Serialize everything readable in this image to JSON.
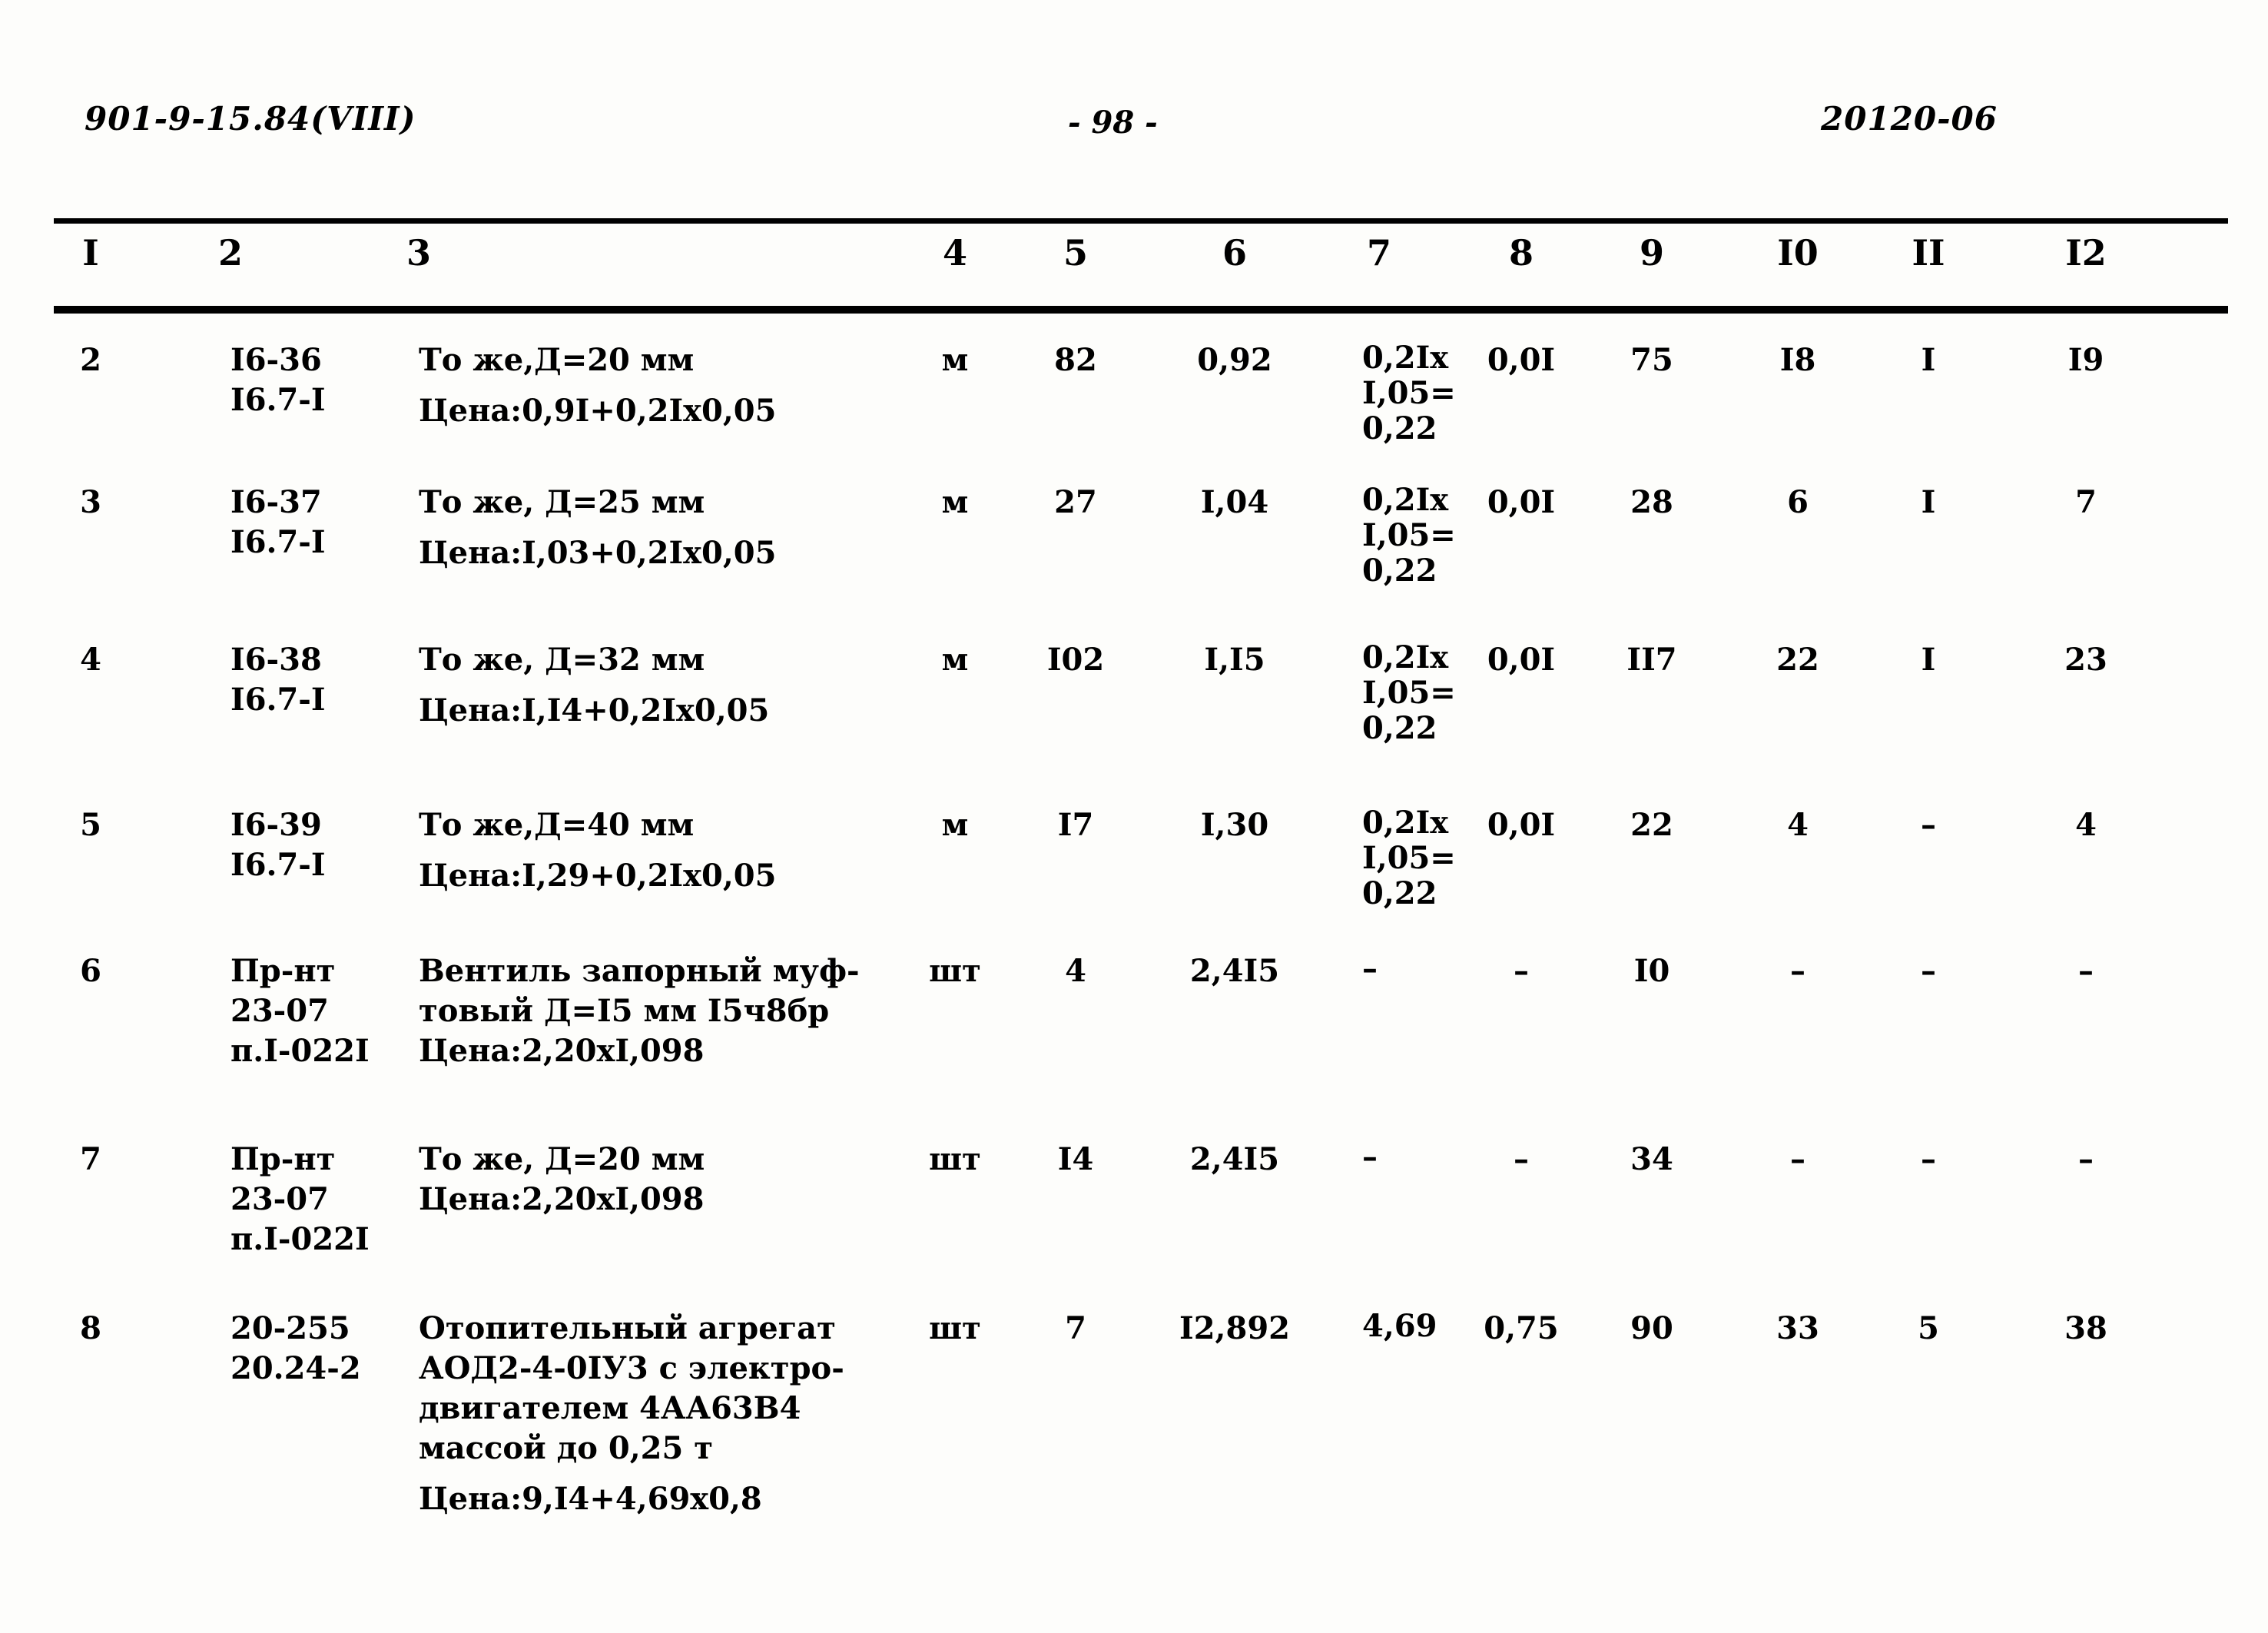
{
  "header": {
    "left_code": "901-9-15.84(VIII)",
    "page_number": "- 98 -",
    "right_code": "20120-06"
  },
  "table": {
    "column_headers": [
      "I",
      "2",
      "3",
      "4",
      "5",
      "6",
      "7",
      "8",
      "9",
      "I0",
      "II",
      "I2"
    ],
    "rows": [
      {
        "n": "2",
        "code_lines": [
          "I6-36",
          "I6.7-I"
        ],
        "desc_lines": [
          "То же,Д=20 мм",
          "",
          "Цена:0,9I+0,2Iх0,05"
        ],
        "unit": "м",
        "qty": "82",
        "c6": "0,92",
        "c7_l1": "0,2Iх",
        "c7_l2": "I,05=",
        "c7_l3": "0,22",
        "c8": "0,0I",
        "c9": "75",
        "c10": "I8",
        "c11": "I",
        "c12": "I9"
      },
      {
        "n": "3",
        "code_lines": [
          "I6-37",
          "I6.7-I"
        ],
        "desc_lines": [
          "То же, Д=25 мм",
          "",
          "Цена:I,03+0,2Iх0,05"
        ],
        "unit": "м",
        "qty": "27",
        "c6": "I,04",
        "c7_l1": "0,2Iх",
        "c7_l2": "I,05=",
        "c7_l3": "0,22",
        "c8": "0,0I",
        "c9": "28",
        "c10": "6",
        "c11": "I",
        "c12": "7"
      },
      {
        "n": "4",
        "code_lines": [
          "I6-38",
          "I6.7-I"
        ],
        "desc_lines": [
          "То же, Д=32 мм",
          "",
          "Цена:I,I4+0,2Iх0,05"
        ],
        "unit": "м",
        "qty": "I02",
        "c6": "I,I5",
        "c7_l1": "0,2Iх",
        "c7_l2": "I,05=",
        "c7_l3": "0,22",
        "c8": "0,0I",
        "c9": "II7",
        "c10": "22",
        "c11": "I",
        "c12": "23"
      },
      {
        "n": "5",
        "code_lines": [
          "I6-39",
          "I6.7-I"
        ],
        "desc_lines": [
          "То же,Д=40 мм",
          "",
          "Цена:I,29+0,2Iх0,05"
        ],
        "unit": "м",
        "qty": "I7",
        "c6": "I,30",
        "c7_l1": "0,2Iх",
        "c7_l2": "I,05=",
        "c7_l3": "0,22",
        "c8": "0,0I",
        "c9": "22",
        "c10": "4",
        "c11": "–",
        "c12": "4"
      },
      {
        "n": "6",
        "code_lines": [
          "Пр-нт",
          "23-07",
          "п.I-022I"
        ],
        "desc_lines": [
          "Вентиль запорный муф-",
          "товый Д=I5 мм I5ч8бр",
          "Цена:2,20хI,098"
        ],
        "unit": "шт",
        "qty": "4",
        "c6": "2,4I5",
        "c7_l1": "–",
        "c7_l2": "",
        "c7_l3": "",
        "c8": "–",
        "c9": "I0",
        "c10": "–",
        "c11": "–",
        "c12": "–"
      },
      {
        "n": "7",
        "code_lines": [
          "Пр-нт",
          "23-07",
          "п.I-022I"
        ],
        "desc_lines": [
          "То же, Д=20 мм",
          "Цена:2,20хI,098"
        ],
        "unit": "шт",
        "qty": "I4",
        "c6": "2,4I5",
        "c7_l1": "–",
        "c7_l2": "",
        "c7_l3": "",
        "c8": "–",
        "c9": "34",
        "c10": "–",
        "c11": "–",
        "c12": "–"
      },
      {
        "n": "8",
        "code_lines": [
          "20-255",
          "20.24-2"
        ],
        "desc_lines": [
          "Отопительный агрегат",
          "АОД2-4-0IУ3 с электро-",
          "двигателем 4АА63В4",
          "массой до 0,25 т",
          "",
          "Цена:9,I4+4,69х0,8"
        ],
        "unit": "шт",
        "qty": "7",
        "c6": "I2,892",
        "c7_l1": "4,69",
        "c7_l2": "",
        "c7_l3": "",
        "c8": "0,75",
        "c9": "90",
        "c10": "33",
        "c11": "5",
        "c12": "38"
      }
    ]
  }
}
